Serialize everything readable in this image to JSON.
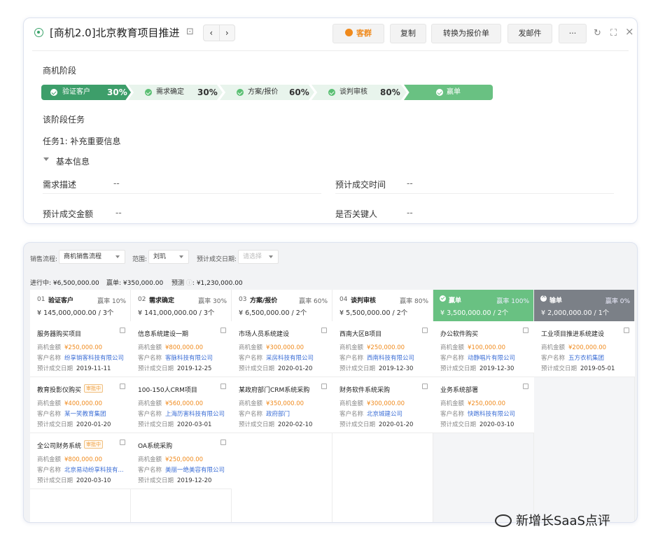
{
  "header": {
    "title": "[商机2.0]北京教育项目推进",
    "buttons": {
      "kequn": "客群",
      "copy": "复制",
      "convert": "转换为报价单",
      "send": "发邮件",
      "more": "···"
    },
    "prev": "‹",
    "next": "›",
    "refresh": "↻",
    "expand": "⛶",
    "close": "×",
    "lock": "⊡"
  },
  "stage_section": {
    "label": "商机阶段",
    "stages": [
      {
        "name": "验证客户",
        "pct": "30%"
      },
      {
        "name": "需求确定",
        "pct": "30%"
      },
      {
        "name": "方案/报价",
        "pct": "60%"
      },
      {
        "name": "谈判审核",
        "pct": "80%"
      },
      {
        "name": "赢单",
        "pct": ""
      }
    ]
  },
  "task_section": {
    "label": "该阶段任务",
    "task": "任务1: 补充重要信息"
  },
  "basic_info": {
    "label": "基本信息",
    "fields": [
      {
        "label": "需求描述",
        "value": "--"
      },
      {
        "label": "预计成交时间",
        "value": "--"
      },
      {
        "label": "预计成交金额",
        "value": "--"
      },
      {
        "label": "是否关键人",
        "value": "--"
      }
    ]
  },
  "filters": {
    "flow_label": "销售流程:",
    "flow_value": "商机销售流程",
    "scope_label": "范围:",
    "scope_value": "刘玑",
    "date_label": "预计成交日期:",
    "date_placeholder": "请选择"
  },
  "summary": {
    "in_progress_label": "进行中:",
    "in_progress_value": "¥6,500,000.00",
    "won_label": "赢单:",
    "won_value": "¥350,000.00",
    "forecast_label": "预测",
    "forecast_hint": "ⓘ",
    "forecast_value": "¥1,230,000.00"
  },
  "card_labels": {
    "amount": "商机金额",
    "customer": "客户名称",
    "date": "预计成交日期"
  },
  "columns": [
    {
      "no": "01",
      "name": "验证客户",
      "rate": "赢率 10%",
      "amount": "¥ 145,000,000.00 / 3个",
      "type": "normal",
      "cards": [
        {
          "title": "服务器购买项目",
          "tag": "",
          "amount": "¥250,000.00",
          "customer": "纷享销客科技有限公司",
          "date": "2019-11-11"
        },
        {
          "title": "教育投影仪购买",
          "tag": "审批中",
          "amount": "¥400,000.00",
          "customer": "某一笑教育集团",
          "date": "2020-01-20"
        },
        {
          "title": "全公司财务系统",
          "tag": "审批中",
          "amount": "¥800,000.00",
          "customer": "北京易动纷享科技有...",
          "date": "2020-03-10"
        }
      ]
    },
    {
      "no": "02",
      "name": "需求确定",
      "rate": "赢率 30%",
      "amount": "¥ 141,000,000.00 / 3个",
      "type": "normal",
      "cards": [
        {
          "title": "信息系统建设一期",
          "tag": "",
          "amount": "¥800,000.00",
          "customer": "客脉科技有限公司",
          "date": "2019-12-25"
        },
        {
          "title": "100-150人CRM项目",
          "tag": "",
          "amount": "¥560,000.00",
          "customer": "上海历害科技有限公司",
          "date": "2020-03-01"
        },
        {
          "title": "OA系统采购",
          "tag": "",
          "amount": "¥250,000.00",
          "customer": "美丽一绝美容有限公司",
          "date": "2019-12-20"
        }
      ]
    },
    {
      "no": "03",
      "name": "方案/报价",
      "rate": "赢率 60%",
      "amount": "¥ 6,500,000.00 / 2个",
      "type": "normal",
      "cards": [
        {
          "title": "市场人员系统建设",
          "tag": "",
          "amount": "¥300,000.00",
          "customer": "采房科技有限公司",
          "date": "2020-01-20"
        },
        {
          "title": "某政府部门CRM系统采购",
          "tag": "",
          "amount": "¥350,000.00",
          "customer": "政府部门",
          "date": "2020-02-10"
        }
      ]
    },
    {
      "no": "04",
      "name": "谈判审核",
      "rate": "赢率 80%",
      "amount": "¥ 5,500,000.00 / 2个",
      "type": "normal",
      "cards": [
        {
          "title": "西南大区B项目",
          "tag": "",
          "amount": "¥250,000.00",
          "customer": "西南科技有限公司",
          "date": "2019-12-30"
        },
        {
          "title": "财务软件系统采购",
          "tag": "",
          "amount": "¥300,000.00",
          "customer": "北京城建公司",
          "date": "2020-01-20"
        }
      ]
    },
    {
      "no": "",
      "name": "赢单",
      "rate": "赢率 100%",
      "amount": "¥ 3,500,000.00 / 2个",
      "type": "win",
      "cards": [
        {
          "title": "办公软件购买",
          "tag": "",
          "amount": "¥100,000.00",
          "customer": "动静唱片有限公司",
          "date": "2019-12-30"
        },
        {
          "title": "业务系统部署",
          "tag": "",
          "amount": "¥250,000.00",
          "customer": "快跑科技有限公司",
          "date": "2020-03-10"
        }
      ]
    },
    {
      "no": "",
      "name": "输单",
      "rate": "赢率 0%",
      "amount": "¥ 2,000,000.00 / 1个",
      "type": "lose",
      "cards": [
        {
          "title": "工业项目推进系统建设",
          "tag": "",
          "amount": "¥200,000.00",
          "customer": "五方衣机集团",
          "date": "2019-05-01"
        }
      ]
    }
  ],
  "watermark": "新增长SaaS点评"
}
